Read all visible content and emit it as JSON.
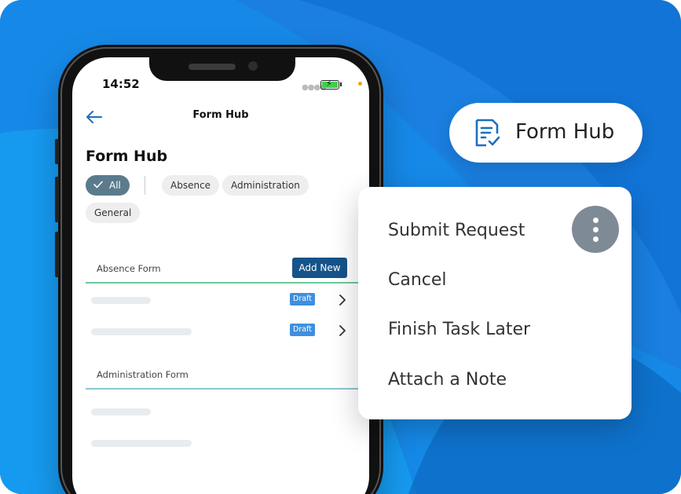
{
  "colors": {
    "background": "#1a7fe0",
    "accent_dark": "#15538a",
    "chip_active": "#5b7b8c",
    "draft_badge": "#3f8fdf",
    "rule_green": "#6cc79a",
    "rule_teal": "#8cc5cf",
    "kebab_bg": "#7f8a97"
  },
  "status_bar": {
    "time": "14:52",
    "battery_icon": "battery-charging-icon"
  },
  "nav": {
    "back_icon": "arrow-left-icon",
    "title": "Form Hub"
  },
  "page": {
    "title": "Form Hub",
    "filters": [
      {
        "label": "All",
        "selected": true
      },
      {
        "label": "Absence",
        "selected": false
      },
      {
        "label": "Administration",
        "selected": false
      },
      {
        "label": "General",
        "selected": false
      }
    ]
  },
  "sections": [
    {
      "label": "Absence Form",
      "action_label": "Add New",
      "rows": [
        {
          "badge": "Draft"
        },
        {
          "badge": "Draft"
        }
      ]
    },
    {
      "label": "Administration Form",
      "rows": []
    }
  ],
  "hub_pill": {
    "icon": "form-check-icon",
    "label": "Form Hub"
  },
  "menu": {
    "kebab_icon": "more-vertical-icon",
    "items": [
      {
        "label": "Submit Request"
      },
      {
        "label": "Cancel"
      },
      {
        "label": "Finish Task Later"
      },
      {
        "label": "Attach a Note"
      }
    ]
  }
}
